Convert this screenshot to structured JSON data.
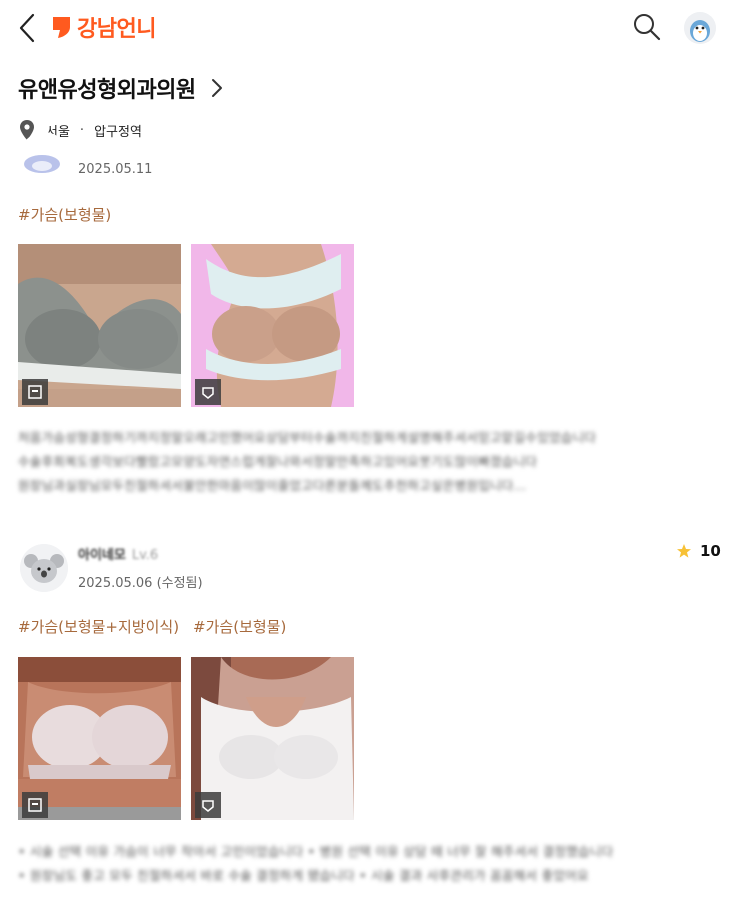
{
  "header": {
    "logo_text": "강남언니",
    "accent_color": "#ff5a1f",
    "icons": {
      "back": "chevron-left-icon",
      "search": "search-icon",
      "profile": "penguin-avatar-icon"
    }
  },
  "hospital": {
    "name": "유앤유성형외과의원",
    "location_city": "서울",
    "location_separator": "·",
    "location_area": "압구정역"
  },
  "reviews": [
    {
      "date": "2025.05.11",
      "tags": [
        "#가슴(보형물)"
      ],
      "photo_count": 2,
      "body_lines": [
        "처음가슴성형결정하기까지정말오래고민했어요상담부터수술까지친절하게설명해주셔서믿고맡길수있었습니다",
        "수술후회복도생각보다빨랐고모양도자연스럽게잘나와서정말만족하고있어요붓기도많이빠졌습니다",
        "원장님과실장님모두친절하셔서불안한마음이많이줄었고다른분들께도추천하고싶은병원입니다..."
      ]
    },
    {
      "author": "아이네모",
      "author_sub": "Lv.6",
      "date": "2025.05.06 (수정됨)",
      "rating": "10",
      "tags": [
        "#가슴(보형물+지방이식)",
        "#가슴(보형물)"
      ],
      "photo_count": 2,
      "body_lines": [
        "• 시술 선택 이유 가슴이 너무 작아서 고민이었습니다 • 병원 선택 이유 상담 때 너무 잘 해주셔서 결정했습니다",
        "• 원장님도 좋고 모두 친절하셔서 바로 수술 결정하게 됐습니다 • 시술 결과 사후관리가 꼼꼼해서 좋았어요"
      ]
    }
  ]
}
